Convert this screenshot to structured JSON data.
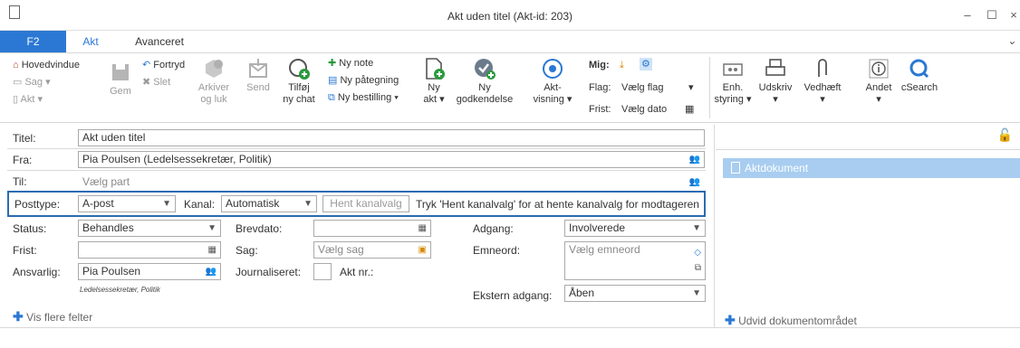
{
  "window": {
    "title": "Akt uden titel (Akt-id: 203)",
    "minimize": "–",
    "maximize": "☐",
    "close": "×"
  },
  "tabs": [
    "F2",
    "Akt",
    "Avanceret"
  ],
  "ribbon": {
    "hovedvindue": "Hovedvindue",
    "sag": "Sag ▾",
    "akt": "Akt ▾",
    "gem": "Gem",
    "fortryd": "Fortryd",
    "slet": "Slet",
    "arkiver": "Arkiver",
    "og_luk": "og luk",
    "send": "Send",
    "tilfoej": "Tilføj",
    "ny_chat": "ny chat",
    "ny_note": "Ny note",
    "ny_paategning": "Ny påtegning",
    "ny_bestilling": "Ny bestilling ▾",
    "ny_akt_1": "Ny",
    "ny_akt_2": "akt ▾",
    "ny_godk_1": "Ny",
    "ny_godk_2": "godkendelse",
    "akt_visning_1": "Akt-",
    "akt_visning_2": "visning ▾",
    "mig": "Mig:",
    "flag": "Flag:",
    "flag_value": "Vælg flag",
    "frist": "Frist:",
    "frist_value": "Vælg dato",
    "enh_1": "Enh.",
    "enh_2": "styring ▾",
    "udskriv": "Udskriv",
    "vedhaeft": "Vedhæft",
    "andet": "Andet",
    "csearch": "cSearch",
    "dropdown": "▾"
  },
  "form": {
    "titel_label": "Titel:",
    "titel_value": "Akt uden titel",
    "fra_label": "Fra:",
    "fra_value": "Pia Poulsen (Ledelsessekretær, Politik)",
    "til_label": "Til:",
    "til_placeholder": "Vælg part",
    "posttype_label": "Posttype:",
    "posttype_value": "A-post",
    "kanal_label": "Kanal:",
    "kanal_value": "Automatisk",
    "hent_kanalvalg": "Hent kanalvalg",
    "kanal_hint": "Tryk 'Hent kanalvalg' for at hente kanalvalg for modtageren",
    "status_label": "Status:",
    "status_value": "Behandles",
    "brevdato_label": "Brevdato:",
    "adgang_label": "Adgang:",
    "adgang_value": "Involverede",
    "frist_label": "Frist:",
    "sag_label": "Sag:",
    "sag_placeholder": "Vælg sag",
    "emneord_label": "Emneord:",
    "emneord_placeholder": "Vælg emneord",
    "ansvarlig_label": "Ansvarlig:",
    "ansvarlig_value": "Pia Poulsen",
    "ansvarlig_sub": "Ledelsessekretær, Politik",
    "journaliseret_label": "Journaliseret:",
    "akt_nr_label": "Akt nr.:",
    "ekstern_label": "Ekstern adgang:",
    "ekstern_value": "Åben",
    "vis_flere": "Vis flere felter"
  },
  "right_panel": {
    "aktdokument": "Aktdokument",
    "udvid": "Udvid dokumentområdet"
  },
  "colors": {
    "accent": "#2b78d4",
    "selection": "#a8cdf0",
    "highlight_border": "#2b6cb0",
    "add_green": "#2b9a3e"
  }
}
